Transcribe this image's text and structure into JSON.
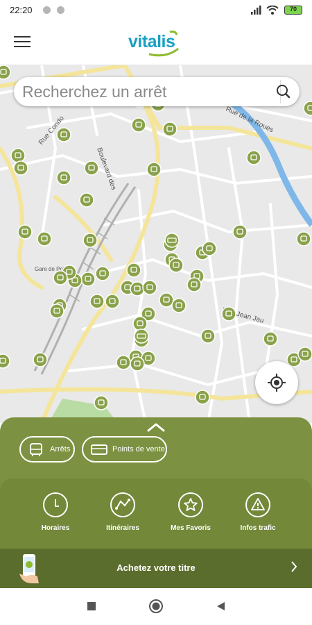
{
  "status": {
    "time": "22:20",
    "battery": "70"
  },
  "header": {
    "logo_text": "vitalis",
    "brand_color": "#1aa0c2",
    "menu_icon": "hamburger-icon"
  },
  "search": {
    "placeholder": "Recherchez un arrêt",
    "icon": "search-icon"
  },
  "map": {
    "street_labels": [
      "Rue Condo",
      "Boulevard des",
      "Rue de la Roues",
      "Gare de Poitiers",
      "Rue Jean Jau",
      "Rue Jean Jaurès"
    ],
    "stop_icon": "bus-stop-marker-icon",
    "pos_icon": "point-of-sale-marker-icon",
    "marker_color": "#8aa24b"
  },
  "sheet": {
    "filters": [
      {
        "label": "Arrêts",
        "icon": "bus-icon"
      },
      {
        "label": "Points de vente",
        "icon": "shop-icon"
      }
    ],
    "actions": [
      {
        "label": "Horaires",
        "icon": "clock-icon"
      },
      {
        "label": "Itinéraires",
        "icon": "route-icon"
      },
      {
        "label": "Mes Favoris",
        "icon": "star-icon"
      },
      {
        "label": "Infos trafic",
        "icon": "warning-icon"
      }
    ],
    "buy": {
      "label": "Achetez votre titre",
      "icon": "phone-ticket-icon"
    },
    "colors": {
      "sheet": "#7d9142",
      "inner": "#738839",
      "buy_bar": "#5b6d2d"
    }
  },
  "navbar": {
    "buttons": [
      "recent-apps-icon",
      "home-icon",
      "back-icon"
    ]
  }
}
